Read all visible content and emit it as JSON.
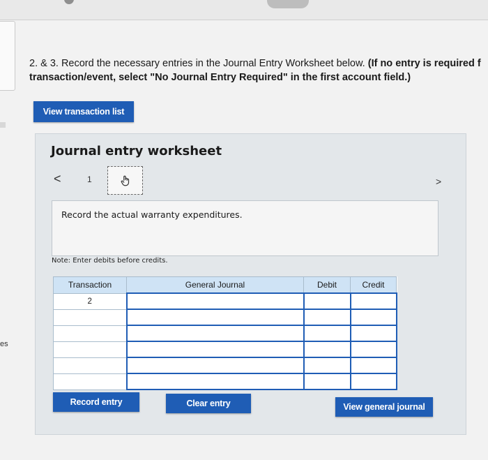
{
  "instructions": {
    "lead": "2. & 3. Record the necessary entries in the Journal Entry Worksheet below.",
    "bold_line1": "(If no entry is required f",
    "bold_line2": "transaction/event, select \"No Journal Entry Required\" in the first account field.)"
  },
  "buttons": {
    "view_transaction_list": "View transaction list",
    "record_entry": "Record entry",
    "clear_entry": "Clear entry",
    "view_general_journal": "View general journal"
  },
  "worksheet": {
    "title": "Journal entry worksheet",
    "prev": "<",
    "next": ">",
    "entry_number": "1",
    "description": "Record the actual warranty expenditures.",
    "note": "Note: Enter debits before credits."
  },
  "table": {
    "headers": [
      "Transaction",
      "General Journal",
      "Debit",
      "Credit"
    ],
    "rows": [
      {
        "transaction": "2",
        "account": "",
        "debit": "",
        "credit": ""
      },
      {
        "transaction": "",
        "account": "",
        "debit": "",
        "credit": ""
      },
      {
        "transaction": "",
        "account": "",
        "debit": "",
        "credit": ""
      },
      {
        "transaction": "",
        "account": "",
        "debit": "",
        "credit": ""
      },
      {
        "transaction": "",
        "account": "",
        "debit": "",
        "credit": ""
      },
      {
        "transaction": "",
        "account": "",
        "debit": "",
        "credit": ""
      }
    ]
  },
  "side_label": "es",
  "icons": {
    "tab": "hand-pointer-icon"
  },
  "colors": {
    "accent": "#1f5db5",
    "header": "#cfe3f5",
    "panel": "#e3e7ea"
  }
}
